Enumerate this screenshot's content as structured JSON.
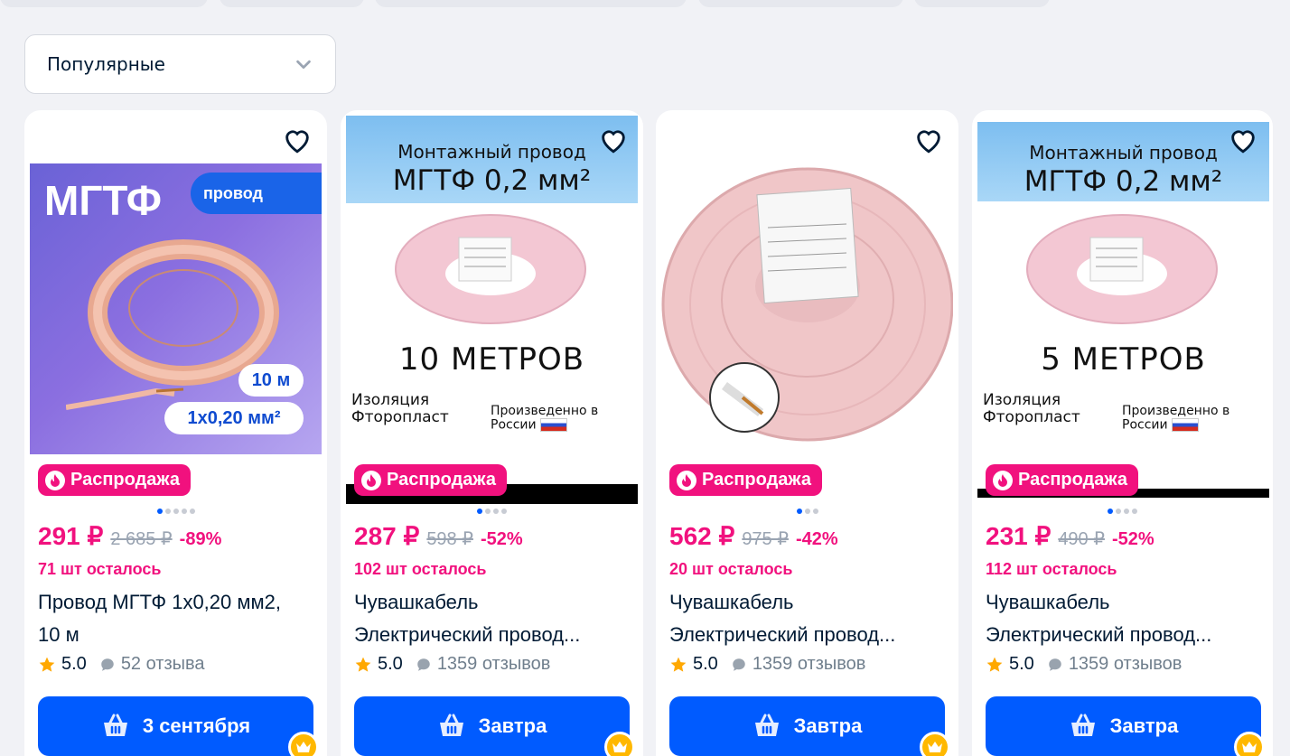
{
  "sort": {
    "label": "Популярные"
  },
  "colors": {
    "accent": "#005bff",
    "sale": "#f1117e",
    "rating_star": "#ffa800"
  },
  "products": [
    {
      "photo": {
        "brand": "МГТФ",
        "tag": "провод",
        "length": "10 м",
        "size": "1х0,20 мм²"
      },
      "badge": "Распродажа",
      "dots": 5,
      "active_dot": 0,
      "price": "291 ₽",
      "old_price": "2 685 ₽",
      "discount": "-89%",
      "stock": "71 шт осталось",
      "title_line1": "Провод МГТФ 1х0,20 мм2,",
      "title_line2": "10 м",
      "rating": "5.0",
      "reviews": "52 отзыва",
      "delivery": "3 сентября"
    },
    {
      "photo": {
        "top_line1": "Монтажный провод",
        "top_line2": "МГТФ 0,2 мм²",
        "meters": "10 МЕТРОВ",
        "iso1": "Изоляция",
        "iso2": "Фторопласт",
        "made1": "Произведенно в",
        "made2": "России"
      },
      "badge": "Распродажа",
      "dots": 4,
      "active_dot": 0,
      "price": "287 ₽",
      "old_price": "598 ₽",
      "discount": "-52%",
      "stock": "102 шт осталось",
      "title_line1": "Чувашкабель",
      "title_line2": "Электрический провод...",
      "rating": "5.0",
      "reviews": "1359 отзывов",
      "delivery": "Завтра"
    },
    {
      "photo": {},
      "badge": "Распродажа",
      "dots": 3,
      "active_dot": 0,
      "price": "562 ₽",
      "old_price": "975 ₽",
      "discount": "-42%",
      "stock": "20 шт осталось",
      "title_line1": "Чувашкабель",
      "title_line2": "Электрический провод...",
      "rating": "5.0",
      "reviews": "1359 отзывов",
      "delivery": "Завтра"
    },
    {
      "photo": {
        "top_line1": "Монтажный провод",
        "top_line2": "МГТФ 0,2 мм²",
        "meters": "5 МЕТРОВ",
        "iso1": "Изоляция",
        "iso2": "Фторопласт",
        "made1": "Произведенно в",
        "made2": "России"
      },
      "badge": "Распродажа",
      "dots": 4,
      "active_dot": 0,
      "price": "231 ₽",
      "old_price": "490 ₽",
      "discount": "-52%",
      "stock": "112 шт осталось",
      "title_line1": "Чувашкабель",
      "title_line2": "Электрический провод...",
      "rating": "5.0",
      "reviews": "1359 отзывов",
      "delivery": "Завтра"
    }
  ]
}
